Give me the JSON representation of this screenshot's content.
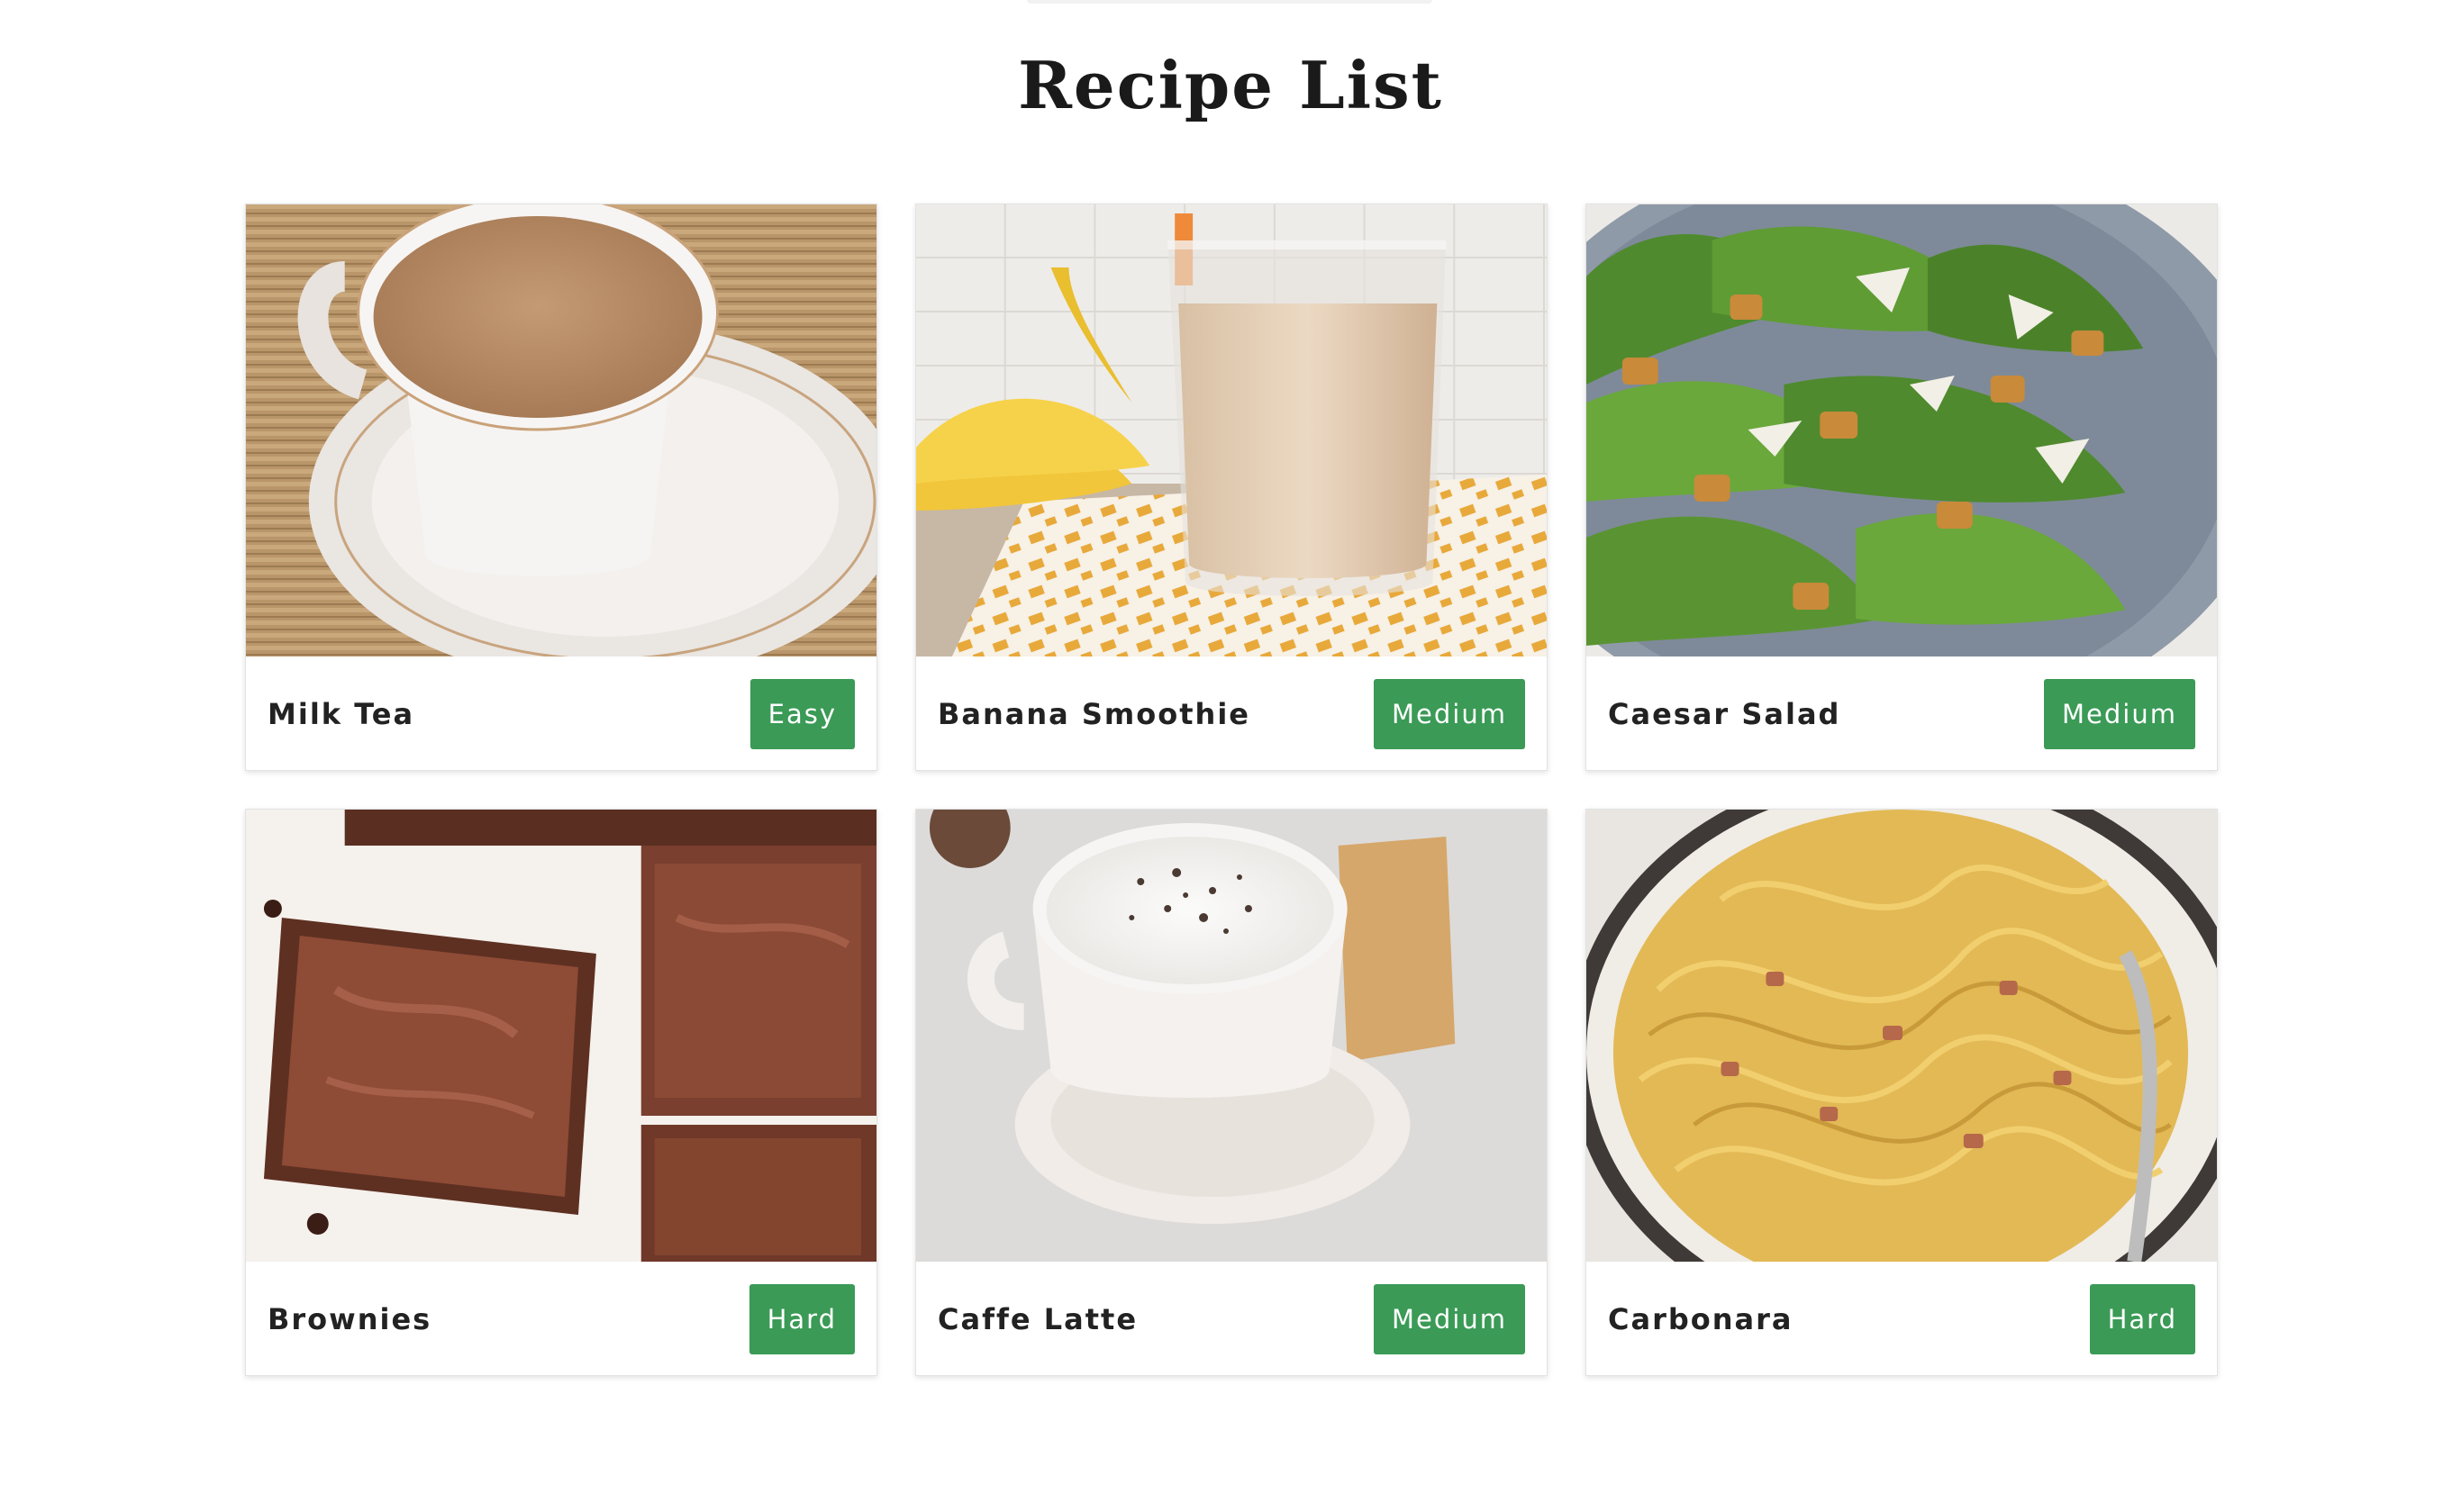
{
  "page": {
    "title": "Recipe List"
  },
  "colors": {
    "badge_background": "#3a9a56",
    "badge_text": "#ffffff",
    "title_text": "#1a1a1a",
    "card_border": "#e3e3e3"
  },
  "recipes": [
    {
      "name": "Milk Tea",
      "difficulty": "Easy",
      "image": "milk-tea-photo"
    },
    {
      "name": "Banana Smoothie",
      "difficulty": "Medium",
      "image": "banana-smoothie-photo"
    },
    {
      "name": "Caesar Salad",
      "difficulty": "Medium",
      "image": "caesar-salad-photo"
    },
    {
      "name": "Brownies",
      "difficulty": "Hard",
      "image": "brownies-photo"
    },
    {
      "name": "Caffe Latte",
      "difficulty": "Medium",
      "image": "caffe-latte-photo"
    },
    {
      "name": "Carbonara",
      "difficulty": "Hard",
      "image": "carbonara-photo"
    }
  ]
}
